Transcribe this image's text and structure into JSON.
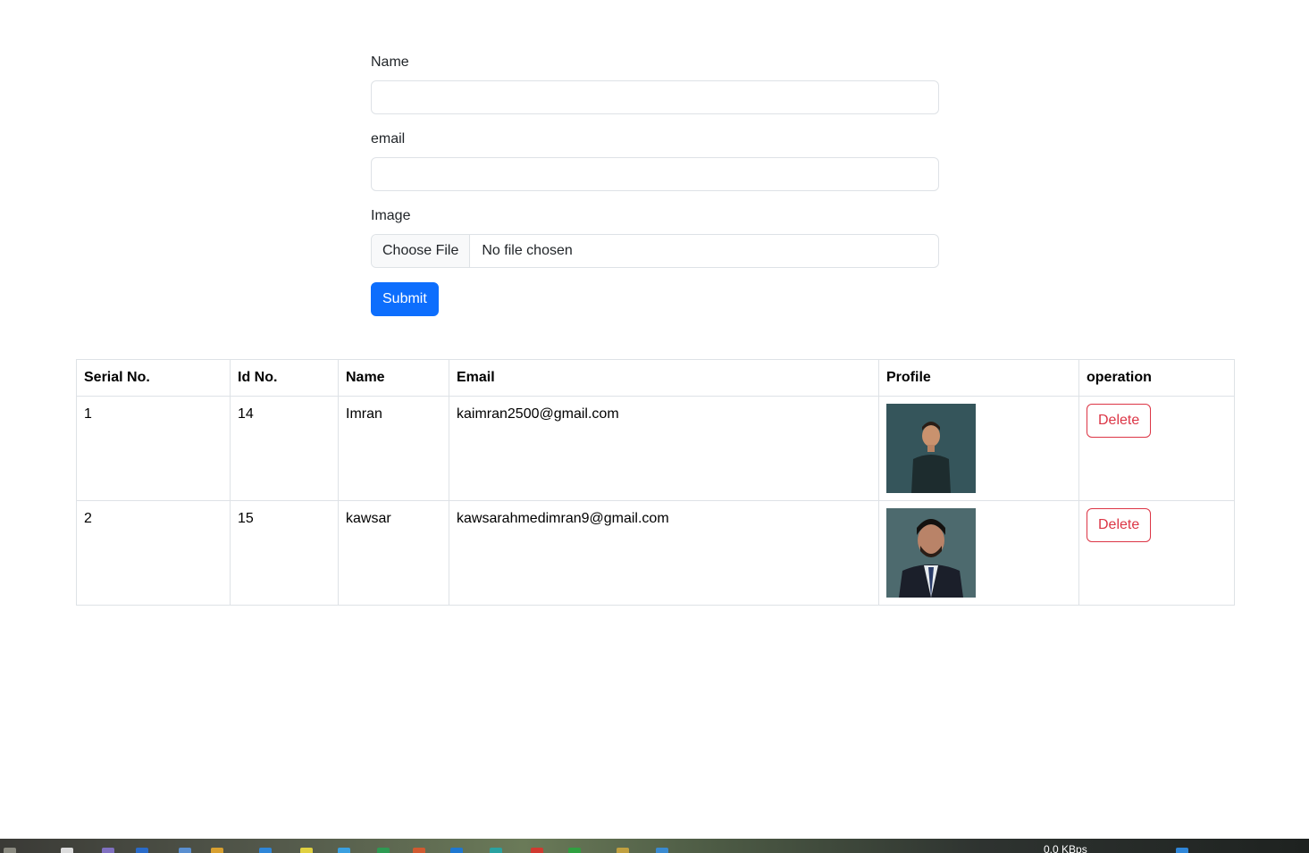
{
  "form": {
    "name_label": "Name",
    "name_value": "",
    "email_label": "email",
    "email_value": "",
    "image_label": "Image",
    "file_button": "Choose File",
    "file_status": "No file chosen",
    "submit_label": "Submit"
  },
  "table": {
    "headers": [
      "Serial No.",
      "Id No.",
      "Name",
      "Email",
      "Profile",
      "operation"
    ],
    "rows": [
      {
        "serial": "1",
        "id": "14",
        "name": "Imran",
        "email": "kaimran2500@gmail.com",
        "profile": "profile-photo",
        "action": "Delete"
      },
      {
        "serial": "2",
        "id": "15",
        "name": "kawsar",
        "email": "kawsarahmedimran9@gmail.com",
        "profile": "profile-photo",
        "action": "Delete"
      }
    ]
  },
  "taskbar": {
    "network_speed": "0.0 KBps"
  },
  "colors": {
    "primary": "#0d6efd",
    "danger": "#dc3545",
    "border": "#dee2e6"
  }
}
